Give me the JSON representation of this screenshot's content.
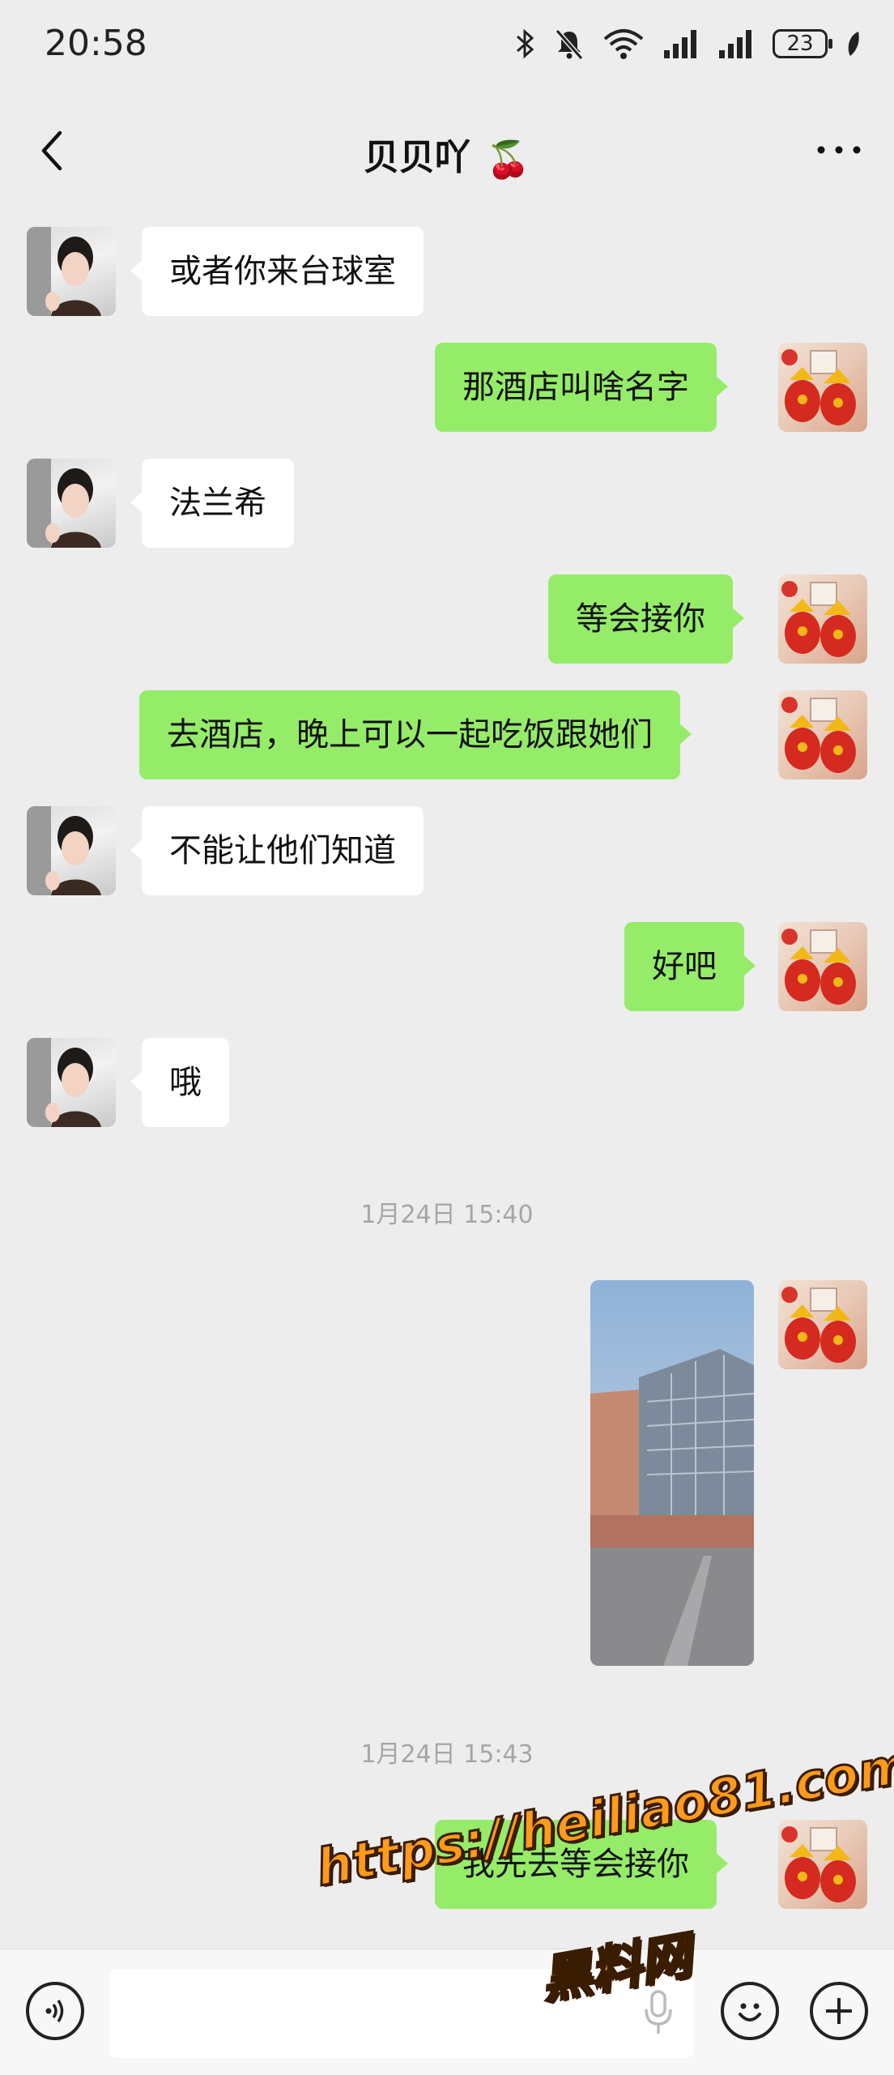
{
  "status_bar": {
    "time": "20:58",
    "battery": "23"
  },
  "header": {
    "title": "贝贝吖",
    "title_emoji": "🍒"
  },
  "messages": [
    {
      "side": "in",
      "text": "或者你来台球室"
    },
    {
      "side": "out",
      "text": "那酒店叫啥名字"
    },
    {
      "side": "in",
      "text": "法兰希"
    },
    {
      "side": "out",
      "text": "等会接你"
    },
    {
      "side": "out",
      "text": "去酒店，晚上可以一起吃饭跟她们"
    },
    {
      "side": "in",
      "text": "不能让他们知道"
    },
    {
      "side": "out",
      "text": "好吧"
    },
    {
      "side": "in",
      "text": "哦"
    },
    {
      "side": "out",
      "text": "我先去等会接你"
    }
  ],
  "timestamps": [
    "1月24日 15:40",
    "1月24日 15:43"
  ],
  "watermark": {
    "url": "https://heiliao81.com",
    "site": "黑料网"
  },
  "colors": {
    "background": "#ededed",
    "incoming_bubble": "#ffffff",
    "outgoing_bubble": "#95ec69",
    "watermark": "#ff9b1a"
  }
}
